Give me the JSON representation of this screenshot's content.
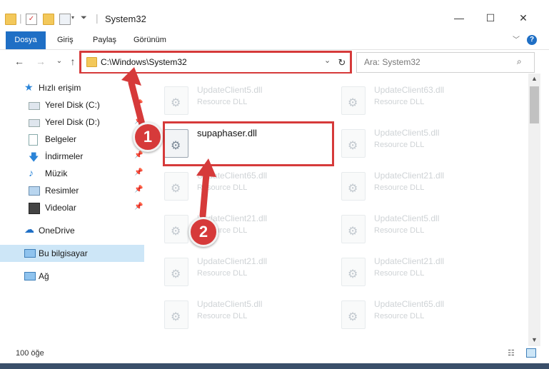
{
  "window": {
    "title": "System32",
    "minimize": "—",
    "maximize": "☐",
    "close": "✕",
    "help": "?"
  },
  "ribbon": {
    "tabs": [
      "Dosya",
      "Giriş",
      "Paylaş",
      "Görünüm"
    ]
  },
  "address": {
    "path": "C:\\Windows\\System32",
    "search_placeholder": "Ara: System32"
  },
  "sidebar": {
    "items": [
      {
        "label": "Hızlı erişim"
      },
      {
        "label": "Yerel Disk (C:)"
      },
      {
        "label": "Yerel Disk (D:)"
      },
      {
        "label": "Belgeler"
      },
      {
        "label": "İndirmeler"
      },
      {
        "label": "Müzik"
      },
      {
        "label": "Resimler"
      },
      {
        "label": "Videolar"
      },
      {
        "label": "OneDrive"
      },
      {
        "label": "Bu bilgisayar"
      },
      {
        "label": "Ağ"
      }
    ]
  },
  "files": [
    {
      "name": "UpdateClient5.dll",
      "type": "Resource DLL"
    },
    {
      "name": "UpdateClient63.dll",
      "type": "Resource DLL"
    },
    {
      "name": "supaphaser.dll",
      "type": ""
    },
    {
      "name": "UpdateClient5.dll",
      "type": "Resource DLL"
    },
    {
      "name": "UpdateClient65.dll",
      "type": "Resource DLL"
    },
    {
      "name": "UpdateClient21.dll",
      "type": "Resource DLL"
    },
    {
      "name": "UpdateClient21.dll",
      "type": "Resource DLL"
    },
    {
      "name": "UpdateClient5.dll",
      "type": "Resource DLL"
    },
    {
      "name": "UpdateClient21.dll",
      "type": "Resource DLL"
    },
    {
      "name": "UpdateClient21.dll",
      "type": "Resource DLL"
    },
    {
      "name": "UpdateClient5.dll",
      "type": "Resource DLL"
    },
    {
      "name": "UpdateClient65.dll",
      "type": "Resource DLL"
    }
  ],
  "status": {
    "count": "100 öğe"
  },
  "annotations": {
    "badge1": "1",
    "badge2": "2"
  },
  "colors": {
    "accent": "#1f6fc5",
    "highlight": "#d63a3a",
    "selected": "#cde6f7"
  }
}
